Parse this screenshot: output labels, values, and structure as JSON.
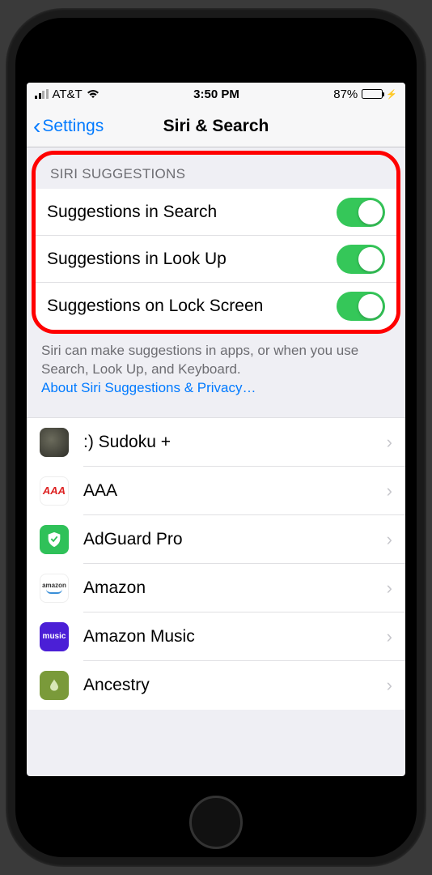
{
  "status": {
    "carrier": "AT&T",
    "time": "3:50 PM",
    "batteryPercent": "87%",
    "batteryFillPercent": 87
  },
  "nav": {
    "back": "Settings",
    "title": "Siri & Search"
  },
  "section": {
    "header": "SIRI SUGGESTIONS",
    "rows": [
      {
        "label": "Suggestions in Search",
        "on": true
      },
      {
        "label": "Suggestions in Look Up",
        "on": true
      },
      {
        "label": "Suggestions on Lock Screen",
        "on": true
      }
    ],
    "footerText": "Siri can make suggestions in apps, or when you use Search, Look Up, and Keyboard.",
    "footerLink": "About Siri Suggestions & Privacy…"
  },
  "apps": [
    {
      "name": ":) Sudoku +",
      "iconClass": "icon-sudoku",
      "iconText": ""
    },
    {
      "name": "AAA",
      "iconClass": "icon-aaa",
      "iconText": "AAA"
    },
    {
      "name": "AdGuard Pro",
      "iconClass": "icon-adguard",
      "iconText": ""
    },
    {
      "name": "Amazon",
      "iconClass": "icon-amazon",
      "iconText": "amazon"
    },
    {
      "name": "Amazon Music",
      "iconClass": "icon-amazonmusic",
      "iconText": "music"
    },
    {
      "name": "Ancestry",
      "iconClass": "icon-ancestry",
      "iconText": ""
    }
  ]
}
